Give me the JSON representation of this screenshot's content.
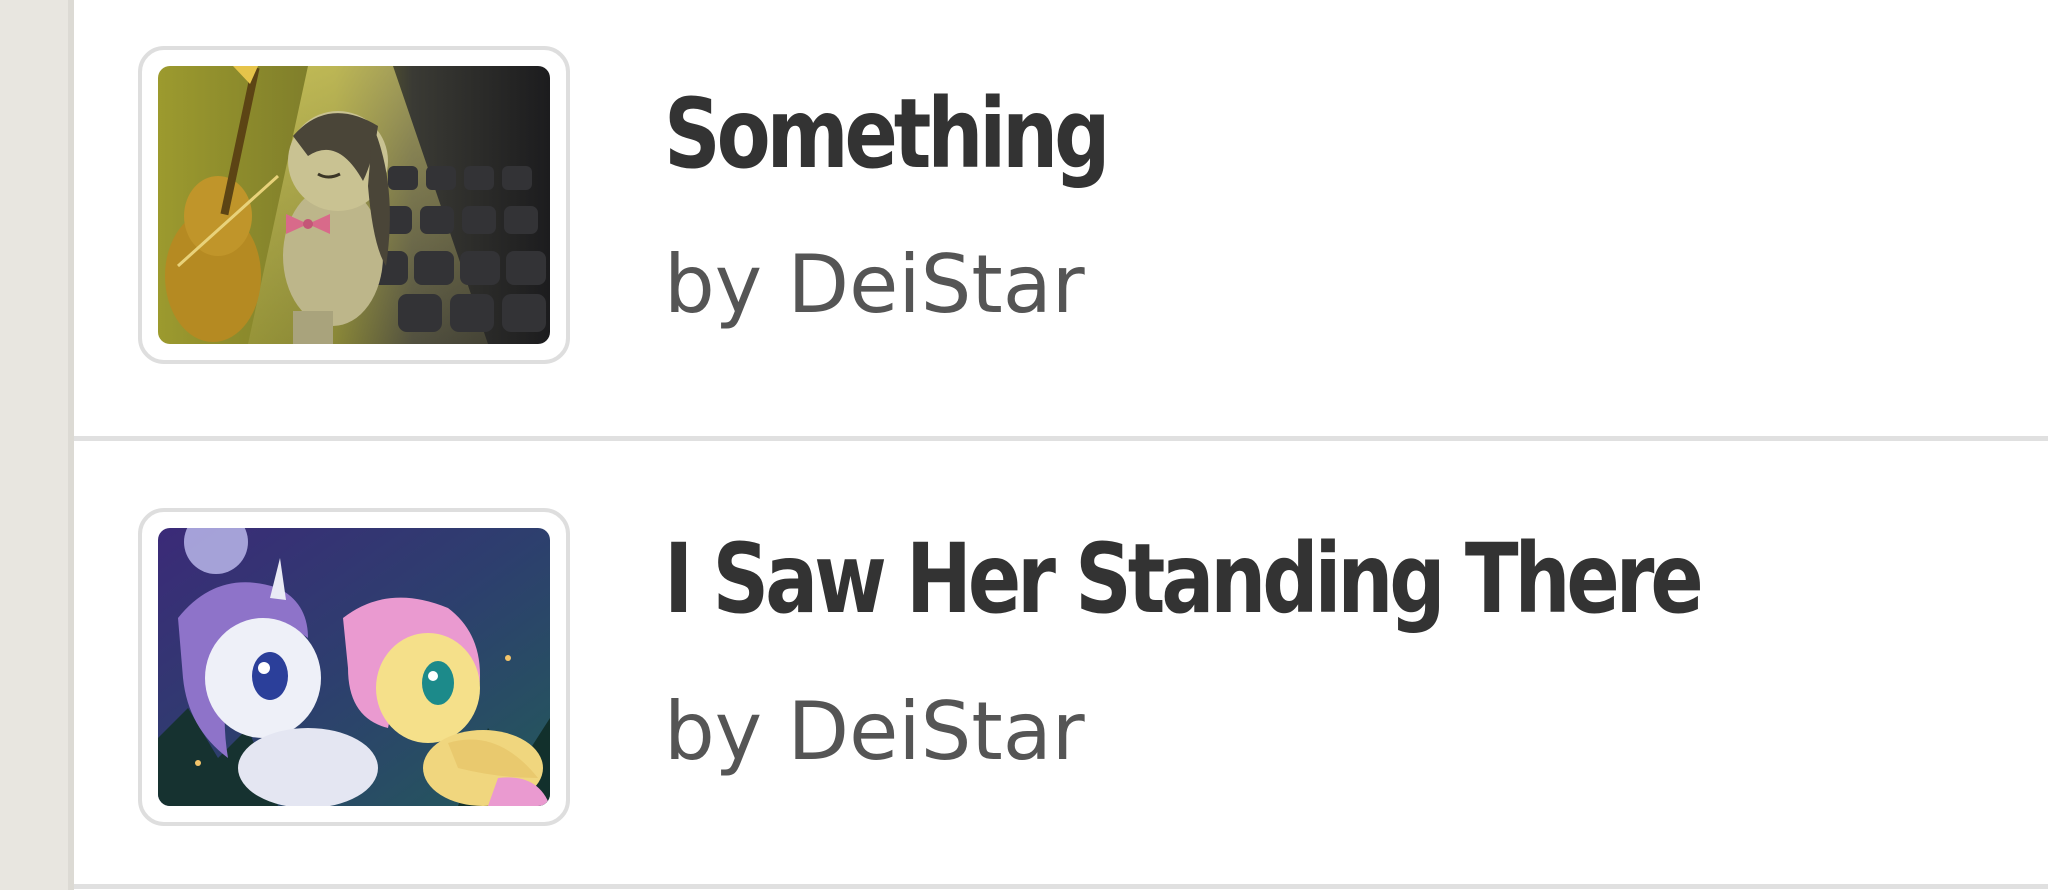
{
  "stories": [
    {
      "title": "Something",
      "author": "by DeiStar",
      "thumbnail": "cello-pony-spotlight-image"
    },
    {
      "title": "I Saw Her Standing There",
      "author": "by DeiStar",
      "thumbnail": "rarity-fluttershy-night-image"
    }
  ],
  "colors": {
    "gutter": "#e8e6e0",
    "title": "#333333",
    "author": "#555555",
    "divider": "#e0e0e0"
  }
}
